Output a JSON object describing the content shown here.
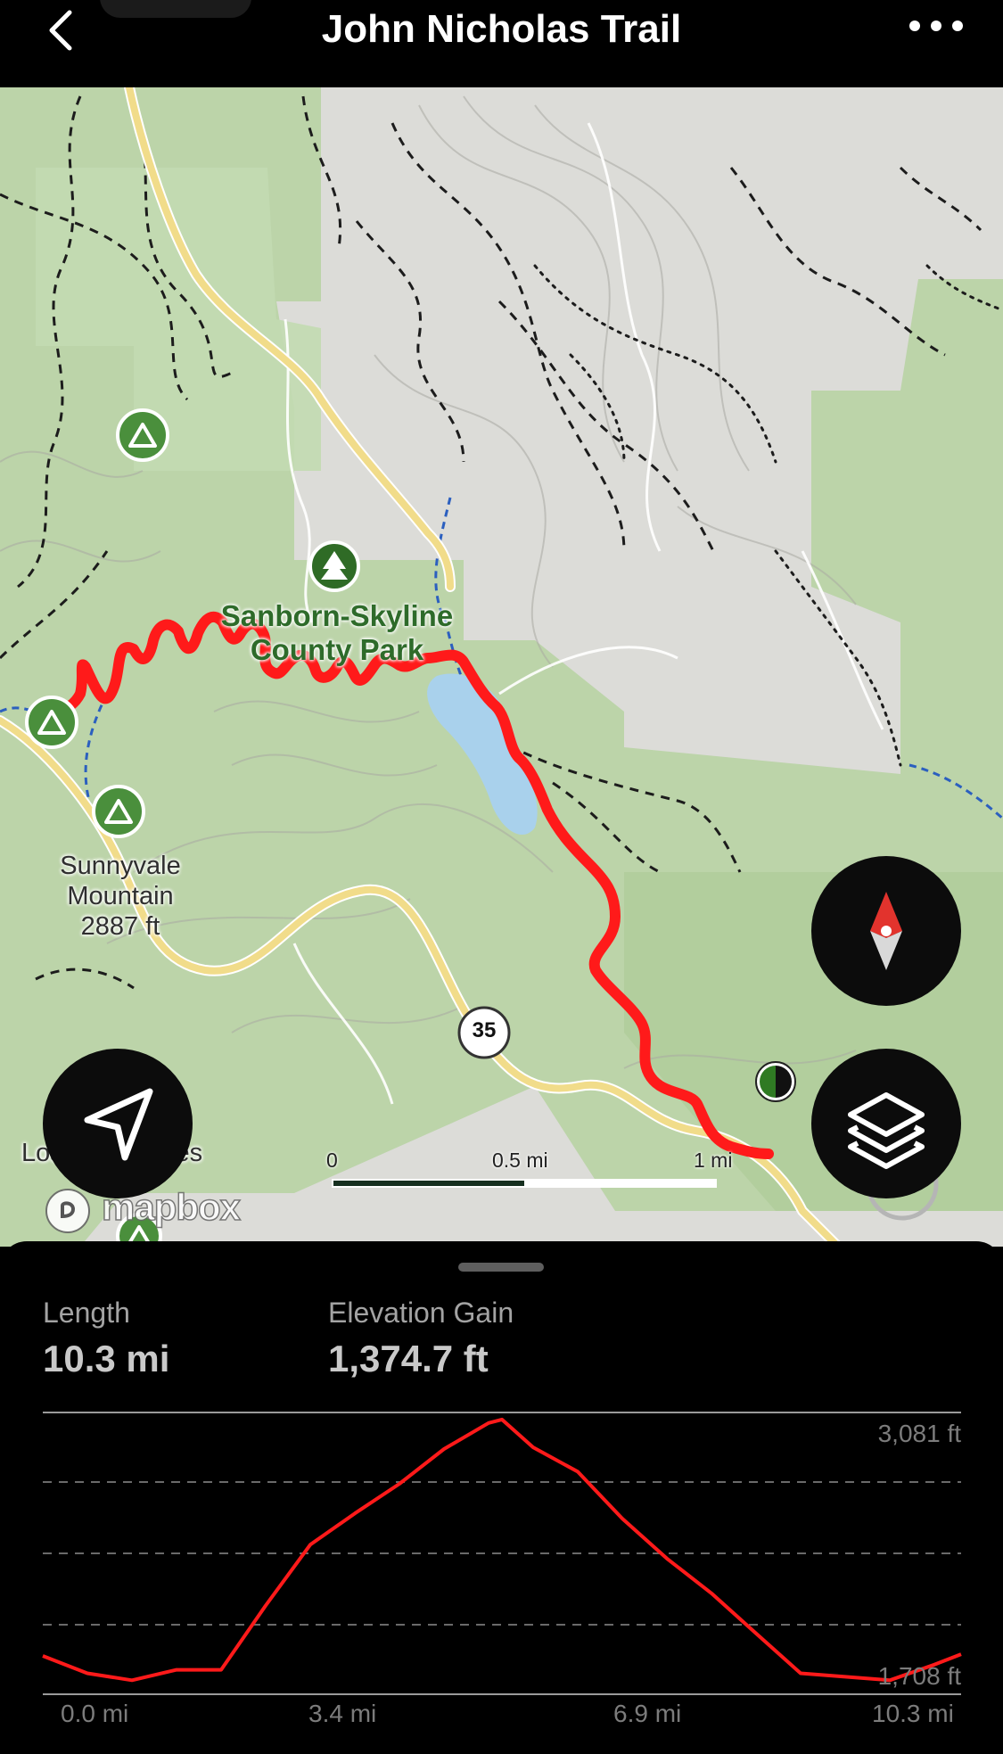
{
  "header": {
    "title": "John Nicholas Trail"
  },
  "map": {
    "park_name": "Sanborn-Skyline County Park",
    "peak": {
      "name": "Sunnyvale Mountain",
      "elevation": "2887 ft"
    },
    "highway_number": "35",
    "town_label": "Los Gatos Ores",
    "attribution": "mapbox",
    "scale": {
      "ticks": [
        "0",
        "0.5 mi",
        "1 mi"
      ]
    },
    "colors": {
      "route": "#ff1a1a",
      "park_green": "#b8d3a5",
      "road": "#f1dc8a",
      "terrain": "#dcdcd8"
    }
  },
  "controls": {
    "back_icon": "chevron-left-icon",
    "more_icon": "ellipsis-icon",
    "compass_icon": "compass-icon",
    "locate_icon": "navigation-arrow-icon",
    "layers_icon": "layers-icon"
  },
  "stats": {
    "length_label": "Length",
    "length_value": "10.3 mi",
    "elevation_label": "Elevation Gain",
    "elevation_value": "1,374.7 ft"
  },
  "chart_data": {
    "type": "area",
    "title": "",
    "xlabel": "",
    "ylabel": "",
    "x_ticks": [
      "0.0 mi",
      "3.4 mi",
      "6.9 mi",
      "10.3 mi"
    ],
    "y_ticks": [
      "3,081 ft",
      "1,708 ft"
    ],
    "xlim": [
      0,
      10.3
    ],
    "ylim": [
      1708,
      3081
    ],
    "grid": true,
    "series": [
      {
        "x": [
          0.0,
          0.5,
          1.0,
          1.5,
          2.0,
          2.5,
          3.0,
          3.5,
          4.0,
          4.5,
          5.0,
          5.15,
          5.5,
          6.0,
          6.5,
          7.0,
          7.5,
          8.0,
          8.5,
          9.0,
          9.5,
          10.0,
          10.3
        ],
        "y": [
          1860,
          1760,
          1720,
          1780,
          1780,
          2150,
          2500,
          2680,
          2850,
          3050,
          3200,
          3220,
          3060,
          2920,
          2650,
          2420,
          2220,
          1990,
          1760,
          1740,
          1720,
          1810,
          1870
        ]
      }
    ],
    "color": "#ff1a1a"
  }
}
